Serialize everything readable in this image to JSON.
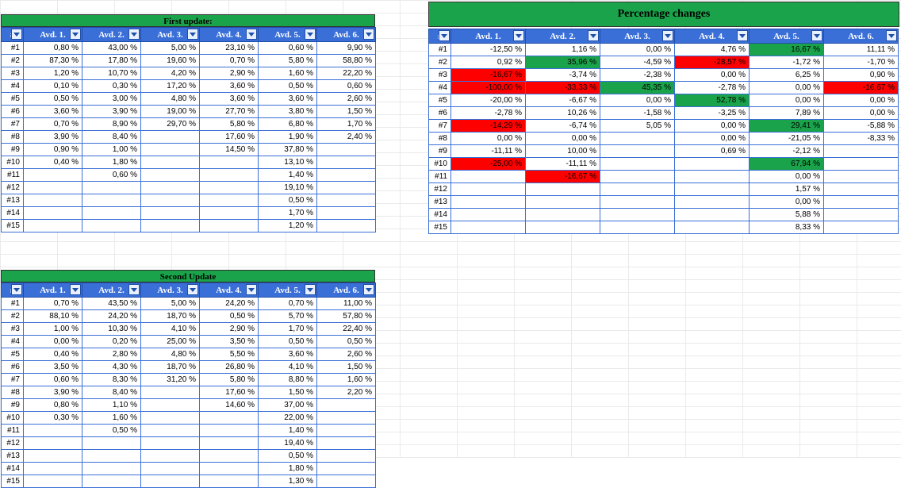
{
  "titles": {
    "first": "First update:",
    "second": "Second Update",
    "pct": "Percentage changes"
  },
  "headers": [
    "#",
    "Avd. 1.",
    "Avd. 2.",
    "Avd. 3.",
    "Avd. 4.",
    "Avd. 5.",
    "Avd. 6."
  ],
  "rowLabels": [
    "#1",
    "#2",
    "#3",
    "#4",
    "#5",
    "#6",
    "#7",
    "#8",
    "#9",
    "#10",
    "#11",
    "#12",
    "#13",
    "#14",
    "#15"
  ],
  "first": [
    [
      "0,80 %",
      "43,00 %",
      "5,00 %",
      "23,10 %",
      "0,60 %",
      "9,90 %"
    ],
    [
      "87,30 %",
      "17,80 %",
      "19,60 %",
      "0,70 %",
      "5,80 %",
      "58,80 %"
    ],
    [
      "1,20 %",
      "10,70 %",
      "4,20 %",
      "2,90 %",
      "1,60 %",
      "22,20 %"
    ],
    [
      "0,10 %",
      "0,30 %",
      "17,20 %",
      "3,60 %",
      "0,50 %",
      "0,60 %"
    ],
    [
      "0,50 %",
      "3,00 %",
      "4,80 %",
      "3,60 %",
      "3,60 %",
      "2,60 %"
    ],
    [
      "3,60 %",
      "3,90 %",
      "19,00 %",
      "27,70 %",
      "3,80 %",
      "1,50 %"
    ],
    [
      "0,70 %",
      "8,90 %",
      "29,70 %",
      "5,80 %",
      "6,80 %",
      "1,70 %"
    ],
    [
      "3,90 %",
      "8,40 %",
      "",
      "17,60 %",
      "1,90 %",
      "2,40 %"
    ],
    [
      "0,90 %",
      "1,00 %",
      "",
      "14,50 %",
      "37,80 %",
      ""
    ],
    [
      "0,40 %",
      "1,80 %",
      "",
      "",
      "13,10 %",
      ""
    ],
    [
      "",
      "0,60 %",
      "",
      "",
      "1,40 %",
      ""
    ],
    [
      "",
      "",
      "",
      "",
      "19,10 %",
      ""
    ],
    [
      "",
      "",
      "",
      "",
      "0,50 %",
      ""
    ],
    [
      "",
      "",
      "",
      "",
      "1,70 %",
      ""
    ],
    [
      "",
      "",
      "",
      "",
      "1,20 %",
      ""
    ]
  ],
  "second": [
    [
      "0,70 %",
      "43,50 %",
      "5,00 %",
      "24,20 %",
      "0,70 %",
      "11,00 %"
    ],
    [
      "88,10 %",
      "24,20 %",
      "18,70 %",
      "0,50 %",
      "5,70 %",
      "57,80 %"
    ],
    [
      "1,00 %",
      "10,30 %",
      "4,10 %",
      "2,90 %",
      "1,70 %",
      "22,40 %"
    ],
    [
      "0,00 %",
      "0,20 %",
      "25,00 %",
      "3,50 %",
      "0,50 %",
      "0,50 %"
    ],
    [
      "0,40 %",
      "2,80 %",
      "4,80 %",
      "5,50 %",
      "3,60 %",
      "2,60 %"
    ],
    [
      "3,50 %",
      "4,30 %",
      "18,70 %",
      "26,80 %",
      "4,10 %",
      "1,50 %"
    ],
    [
      "0,60 %",
      "8,30 %",
      "31,20 %",
      "5,80 %",
      "8,80 %",
      "1,60 %"
    ],
    [
      "3,90 %",
      "8,40 %",
      "",
      "17,60 %",
      "1,50 %",
      "2,20 %"
    ],
    [
      "0,80 %",
      "1,10 %",
      "",
      "14,60 %",
      "37,00 %",
      ""
    ],
    [
      "0,30 %",
      "1,60 %",
      "",
      "",
      "22,00 %",
      ""
    ],
    [
      "",
      "0,50 %",
      "",
      "",
      "1,40 %",
      ""
    ],
    [
      "",
      "",
      "",
      "",
      "19,40 %",
      ""
    ],
    [
      "",
      "",
      "",
      "",
      "0,50 %",
      ""
    ],
    [
      "",
      "",
      "",
      "",
      "1,80 %",
      ""
    ],
    [
      "",
      "",
      "",
      "",
      "1,30 %",
      ""
    ]
  ],
  "pct": [
    [
      {
        "v": "-12,50 %"
      },
      {
        "v": "1,16 %"
      },
      {
        "v": "0,00 %"
      },
      {
        "v": "4,76 %"
      },
      {
        "v": "16,67 %",
        "c": "g"
      },
      {
        "v": "11,11 %"
      }
    ],
    [
      {
        "v": "0,92 %"
      },
      {
        "v": "35,96 %",
        "c": "g"
      },
      {
        "v": "-4,59 %"
      },
      {
        "v": "-28,57 %",
        "c": "r"
      },
      {
        "v": "-1,72 %"
      },
      {
        "v": "-1,70 %"
      }
    ],
    [
      {
        "v": "-16,67 %",
        "c": "r"
      },
      {
        "v": "-3,74 %"
      },
      {
        "v": "-2,38 %"
      },
      {
        "v": "0,00 %"
      },
      {
        "v": "6,25 %"
      },
      {
        "v": "0,90 %"
      }
    ],
    [
      {
        "v": "-100,00 %",
        "c": "r"
      },
      {
        "v": "-33,33 %",
        "c": "r"
      },
      {
        "v": "45,35 %",
        "c": "g"
      },
      {
        "v": "-2,78 %"
      },
      {
        "v": "0,00 %"
      },
      {
        "v": "-16,67 %",
        "c": "r"
      }
    ],
    [
      {
        "v": "-20,00 %"
      },
      {
        "v": "-6,67 %"
      },
      {
        "v": "0,00 %"
      },
      {
        "v": "52,78 %",
        "c": "g"
      },
      {
        "v": "0,00 %"
      },
      {
        "v": "0,00 %"
      }
    ],
    [
      {
        "v": "-2,78 %"
      },
      {
        "v": "10,26 %"
      },
      {
        "v": "-1,58 %"
      },
      {
        "v": "-3,25 %"
      },
      {
        "v": "7,89 %"
      },
      {
        "v": "0,00 %"
      }
    ],
    [
      {
        "v": "-14,29 %",
        "c": "r"
      },
      {
        "v": "-6,74 %"
      },
      {
        "v": "5,05 %"
      },
      {
        "v": "0,00 %"
      },
      {
        "v": "29,41 %",
        "c": "g"
      },
      {
        "v": "-5,88 %"
      }
    ],
    [
      {
        "v": "0,00 %"
      },
      {
        "v": "0,00 %"
      },
      {
        "v": ""
      },
      {
        "v": "0,00 %"
      },
      {
        "v": "-21,05 %"
      },
      {
        "v": "-8,33 %"
      }
    ],
    [
      {
        "v": "-11,11 %"
      },
      {
        "v": "10,00 %"
      },
      {
        "v": ""
      },
      {
        "v": "0,69 %"
      },
      {
        "v": "-2,12 %"
      },
      {
        "v": ""
      }
    ],
    [
      {
        "v": "-25,00 %",
        "c": "r"
      },
      {
        "v": "-11,11 %"
      },
      {
        "v": ""
      },
      {
        "v": ""
      },
      {
        "v": "67,94 %",
        "c": "g"
      },
      {
        "v": ""
      }
    ],
    [
      {
        "v": ""
      },
      {
        "v": "-16,67 %",
        "c": "r"
      },
      {
        "v": ""
      },
      {
        "v": ""
      },
      {
        "v": "0,00 %"
      },
      {
        "v": ""
      }
    ],
    [
      {
        "v": ""
      },
      {
        "v": ""
      },
      {
        "v": ""
      },
      {
        "v": ""
      },
      {
        "v": "1,57 %"
      },
      {
        "v": ""
      }
    ],
    [
      {
        "v": ""
      },
      {
        "v": ""
      },
      {
        "v": ""
      },
      {
        "v": ""
      },
      {
        "v": "0,00 %"
      },
      {
        "v": ""
      }
    ],
    [
      {
        "v": ""
      },
      {
        "v": ""
      },
      {
        "v": ""
      },
      {
        "v": ""
      },
      {
        "v": "5,88 %"
      },
      {
        "v": ""
      }
    ],
    [
      {
        "v": ""
      },
      {
        "v": ""
      },
      {
        "v": ""
      },
      {
        "v": ""
      },
      {
        "v": "8,33 %"
      },
      {
        "v": ""
      }
    ]
  ],
  "chart_data": [
    {
      "type": "table",
      "title": "First update:",
      "columns": [
        "#",
        "Avd. 1.",
        "Avd. 2.",
        "Avd. 3.",
        "Avd. 4.",
        "Avd. 5.",
        "Avd. 6."
      ],
      "rows_ref": "first"
    },
    {
      "type": "table",
      "title": "Second Update",
      "columns": [
        "#",
        "Avd. 1.",
        "Avd. 2.",
        "Avd. 3.",
        "Avd. 4.",
        "Avd. 5.",
        "Avd. 6."
      ],
      "rows_ref": "second"
    },
    {
      "type": "table",
      "title": "Percentage changes",
      "columns": [
        "#",
        "Avd. 1.",
        "Avd. 2.",
        "Avd. 3.",
        "Avd. 4.",
        "Avd. 5.",
        "Avd. 6."
      ],
      "rows_ref": "pct"
    }
  ]
}
